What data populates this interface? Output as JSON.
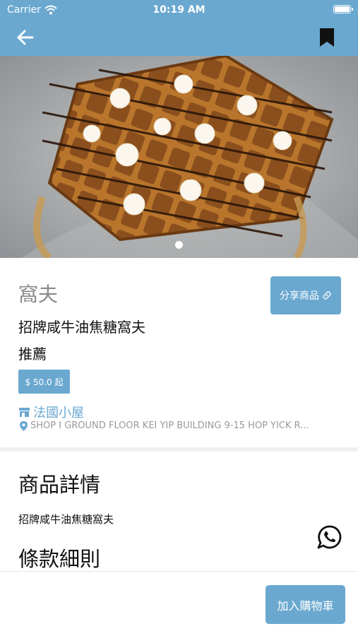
{
  "status_bar": {
    "carrier": "Carrier",
    "time": "10:19 AM"
  },
  "header": {
    "back_icon": "arrow-left-icon",
    "bookmark_icon": "bookmark-icon"
  },
  "hero": {
    "image_alt": "Waffles with cream and chocolate drizzle",
    "page_count": 1,
    "active_page": 1
  },
  "product": {
    "category": "窩夫",
    "name": "招牌咸牛油焦糖窩夫",
    "tag": "推薦",
    "price": "$ 50.0 起",
    "share_label": "分享商品"
  },
  "shop": {
    "name": "法國小屋",
    "address": "SHOP I GROUND FLOOR KEI YIP BUILDING 9-15 HOP YICK R..."
  },
  "details": {
    "title": "商品詳情",
    "text": "招牌咸牛油焦糖窩夫",
    "terms_title": "條款細則"
  },
  "footer": {
    "add_to_cart": "加入購物車"
  },
  "colors": {
    "accent": "#6aa8d0",
    "muted": "#8a8a8a"
  }
}
